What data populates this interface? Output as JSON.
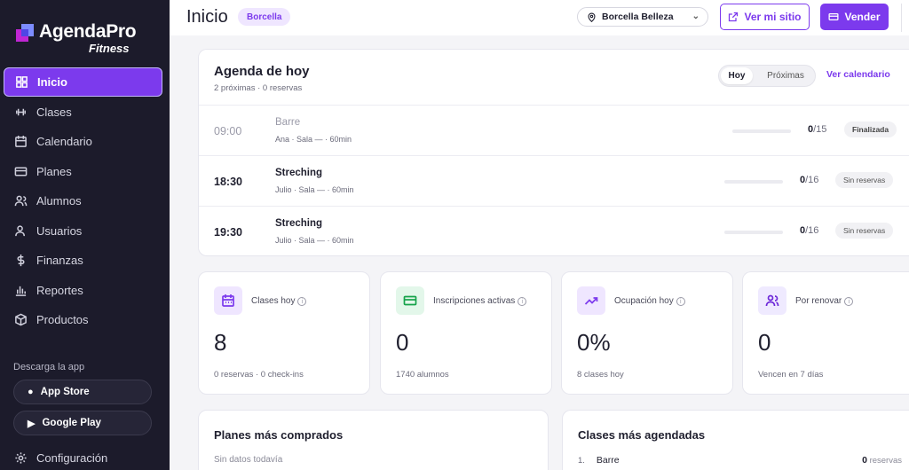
{
  "brand": {
    "name": "AgendaPro",
    "sub": "Fitness"
  },
  "sidebar": {
    "items": [
      {
        "label": "Inicio",
        "icon": "grid-icon",
        "active": true
      },
      {
        "label": "Clases",
        "icon": "dumbbell-icon"
      },
      {
        "label": "Calendario",
        "icon": "calendar-icon"
      },
      {
        "label": "Planes",
        "icon": "card-icon"
      },
      {
        "label": "Alumnos",
        "icon": "users-icon"
      },
      {
        "label": "Usuarios",
        "icon": "user-cog-icon"
      },
      {
        "label": "Finanzas",
        "icon": "dollar-icon"
      },
      {
        "label": "Reportes",
        "icon": "bar-chart-icon"
      },
      {
        "label": "Productos",
        "icon": "box-icon"
      }
    ],
    "download_label": "Descarga la app",
    "app_store": "App Store",
    "google_play": "Google Play",
    "settings": "Configuración"
  },
  "header": {
    "title": "Inicio",
    "brand_pill": "Borcella",
    "location": "Borcella Belleza",
    "ver_sitio": "Ver mi sitio",
    "vender": "Vender"
  },
  "agenda": {
    "title": "Agenda de hoy",
    "subtitle": "2 próximas · 0 reservas",
    "tab_hoy": "Hoy",
    "tab_proximas": "Próximas",
    "ver_calendario": "Ver calendario",
    "rows": [
      {
        "time": "09:00",
        "name": "Barre",
        "meta": "Ana · Sala — · 60min",
        "booked": "0",
        "capacity": "/15",
        "fill": 0,
        "status": "Finalizada",
        "done": true
      },
      {
        "time": "18:30",
        "name": "Streching",
        "meta": "Julio · Sala — · 60min",
        "booked": "0",
        "capacity": "/16",
        "fill": 0,
        "status": "Sin reservas",
        "done": false
      },
      {
        "time": "19:30",
        "name": "Streching",
        "meta": "Julio · Sala — · 60min",
        "booked": "0",
        "capacity": "/16",
        "fill": 0,
        "status": "Sin reservas",
        "done": false
      }
    ]
  },
  "stats": [
    {
      "label": "Clases hoy",
      "value": "8",
      "note": "0 reservas · 0 check-ins",
      "icon": "calendar-icon",
      "color": "#7c3aed",
      "bg": "#efe6ff"
    },
    {
      "label": "Inscripciones activas",
      "value": "0",
      "note": "1740 alumnos",
      "icon": "card-icon",
      "color": "#16a34a",
      "bg": "#e3f7ea"
    },
    {
      "label": "Ocupación hoy",
      "value": "0%",
      "note": "8 clases hoy",
      "icon": "trend-up-icon",
      "color": "#7c3aed",
      "bg": "#efe6ff"
    },
    {
      "label": "Por renovar",
      "value": "0",
      "note": "Vencen en 7 días",
      "icon": "users-icon",
      "color": "#6d28d9",
      "bg": "#efeaff"
    }
  ],
  "planes": {
    "title": "Planes más comprados",
    "empty": "Sin datos todavía"
  },
  "clases_top": {
    "title": "Clases más agendadas",
    "items": [
      {
        "rank": "1.",
        "name": "Barre",
        "count": "0",
        "unit": "reservas"
      }
    ]
  },
  "colors": {
    "accent": "#7c3aed",
    "sidebar_bg": "#1c1b2b"
  }
}
